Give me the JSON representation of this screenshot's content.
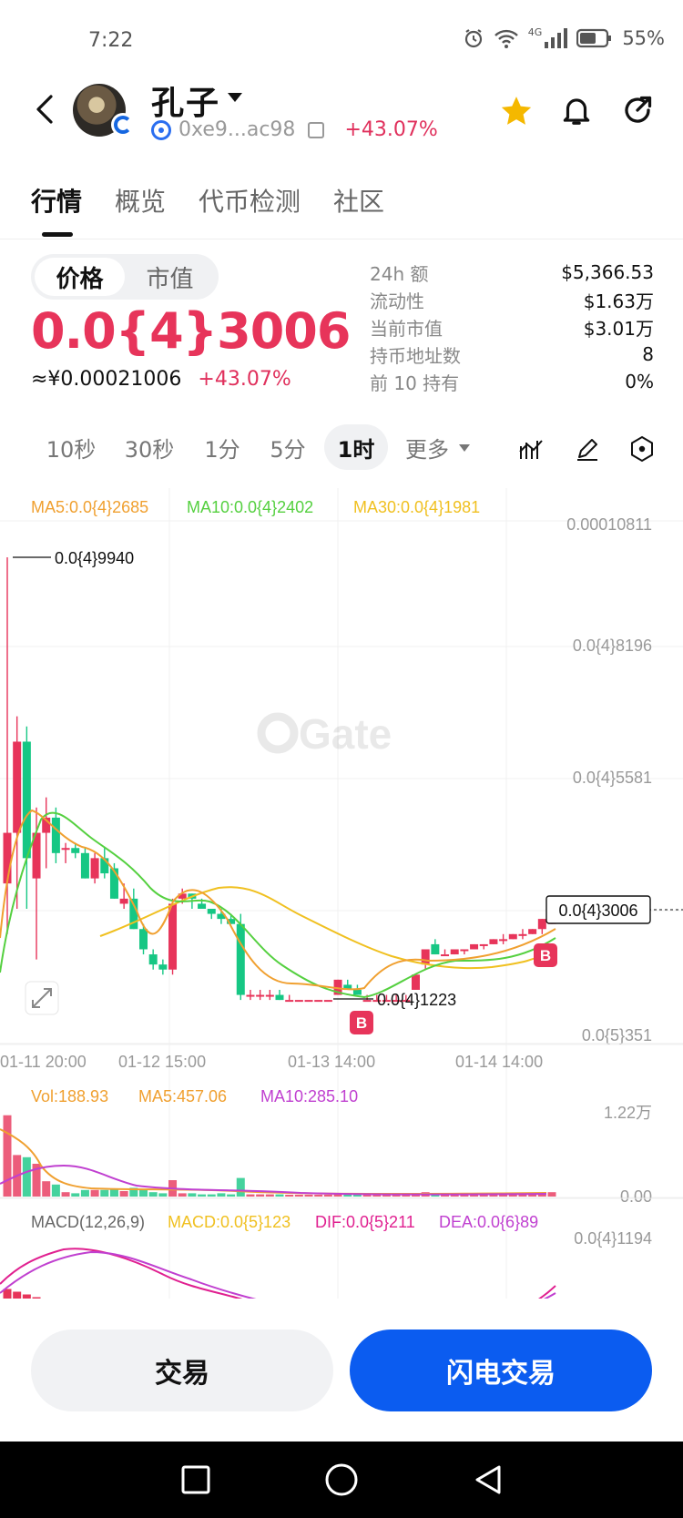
{
  "status_bar": {
    "time": "7:22",
    "battery": "55%",
    "network": "4G"
  },
  "header": {
    "token_name": "孔子",
    "address": "0xe9...ac98",
    "change": "+43.07%"
  },
  "tabs": [
    "行情",
    "概览",
    "代币检测",
    "社区"
  ],
  "price_panel": {
    "segment": [
      "价格",
      "市值"
    ],
    "price": "0.0{4}3006",
    "cny_price": "≈¥0.00021006",
    "change": "+43.07%"
  },
  "stats": [
    {
      "label": "24h  额",
      "value": "$5,366.53"
    },
    {
      "label": "流动性",
      "value": "$1.63万"
    },
    {
      "label": "当前市值",
      "value": "$3.01万"
    },
    {
      "label": "持币地址数",
      "value": "8"
    },
    {
      "label": "前 10 持有",
      "value": "0%"
    }
  ],
  "timeframes": [
    "10秒",
    "30秒",
    "1分",
    "5分",
    "1时",
    "更多"
  ],
  "selected_timeframe": "1时",
  "ma_legend": {
    "ma5": "MA5:0.0{4}2685",
    "ma10": "MA10:0.0{4}2402",
    "ma30": "MA30:0.0{4}1981"
  },
  "y_axis": [
    "0.00010811",
    "0.0{4}8196",
    "0.0{4}5581",
    "0.0{5}351"
  ],
  "x_axis": [
    "01-11 20:00",
    "01-12 15:00",
    "01-13 14:00",
    "01-14 14:00"
  ],
  "annotations": {
    "high": "0.0{4}9940",
    "low": "0.0{4}1223",
    "current": "0.0{4}3006",
    "buy_marker": "B"
  },
  "watermark": "Gate",
  "volume_legend": {
    "vol": "Vol:188.93",
    "ma5": "MA5:457.06",
    "ma10": "MA10:285.10",
    "max": "1.22万",
    "min": "0.00"
  },
  "macd_legend": {
    "label": "MACD(12,26,9)",
    "macd": "MACD:0.0{5}123",
    "dif": "DIF:0.0{5}211",
    "dea": "DEA:0.0{6}89",
    "max": "0.0{4}1194"
  },
  "buttons": {
    "trade": "交易",
    "flash_trade": "闪电交易"
  },
  "colors": {
    "up": "#e7345a",
    "down": "#16c784",
    "accent": "#0b5cf0",
    "ma5": "#f0a030",
    "ma10": "#55d040",
    "ma30": "#f0c020"
  },
  "chart_data": {
    "type": "candlestick",
    "interval": "1时",
    "x_ticks": [
      "01-11 20:00",
      "01-12 15:00",
      "01-13 14:00",
      "01-14 14:00"
    ],
    "y_ticks": [
      "0.00010811",
      "0.0{4}8196",
      "0.0{4}5581",
      "0.0{5}351"
    ],
    "high": "0.0{4}9940",
    "low": "0.0{4}1223",
    "last": "0.0{4}3006",
    "ma": {
      "MA5": "0.0{4}2685",
      "MA10": "0.0{4}2402",
      "MA30": "0.0{4}1981"
    },
    "candles": [
      {
        "o": 3.5e-05,
        "h": 9.94e-05,
        "l": 2.5e-05,
        "c": 4.5e-05
      },
      {
        "o": 4.5e-05,
        "h": 6.8e-05,
        "l": 3e-05,
        "c": 6.3e-05
      },
      {
        "o": 6.3e-05,
        "h": 6.6e-05,
        "l": 3e-05,
        "c": 4e-05
      },
      {
        "o": 3.6e-05,
        "h": 5e-05,
        "l": 2e-05,
        "c": 4.5e-05
      },
      {
        "o": 4.5e-05,
        "h": 5.2e-05,
        "l": 3.8e-05,
        "c": 4.8e-05
      },
      {
        "o": 4.8e-05,
        "h": 5e-05,
        "l": 3.9e-05,
        "c": 4.1e-05
      },
      {
        "o": 4.2e-05,
        "h": 4.3e-05,
        "l": 3.9e-05,
        "c": 4.2e-05
      },
      {
        "o": 4.2e-05,
        "h": 4.3e-05,
        "l": 4e-05,
        "c": 4.1e-05
      },
      {
        "o": 4.1e-05,
        "h": 4.2e-05,
        "l": 3.6e-05,
        "c": 3.6e-05
      },
      {
        "o": 3.6e-05,
        "h": 4.1e-05,
        "l": 3.5e-05,
        "c": 4e-05
      },
      {
        "o": 4e-05,
        "h": 4.2e-05,
        "l": 3.6e-05,
        "c": 3.7e-05
      },
      {
        "o": 3.8e-05,
        "h": 3.9e-05,
        "l": 3.2e-05,
        "c": 3.2e-05
      },
      {
        "o": 3.1e-05,
        "h": 3.5e-05,
        "l": 3e-05,
        "c": 3.2e-05
      },
      {
        "o": 3.2e-05,
        "h": 3.4e-05,
        "l": 2.6e-05,
        "c": 2.6e-05
      },
      {
        "o": 2.6e-05,
        "h": 2.7e-05,
        "l": 2.1e-05,
        "c": 2.2e-05
      },
      {
        "o": 2.1e-05,
        "h": 2.2e-05,
        "l": 1.8e-05,
        "c": 1.9e-05
      },
      {
        "o": 1.9e-05,
        "h": 2e-05,
        "l": 1.7e-05,
        "c": 1.8e-05
      },
      {
        "o": 1.8e-05,
        "h": 3.2e-05,
        "l": 1.7e-05,
        "c": 3.1e-05
      },
      {
        "o": 3.2e-05,
        "h": 3.4e-05,
        "l": 3.1e-05,
        "c": 3.3e-05
      },
      {
        "o": 3.3e-05,
        "h": 3.3e-05,
        "l": 3e-05,
        "c": 3.2e-05
      },
      {
        "o": 3.1e-05,
        "h": 3.2e-05,
        "l": 3e-05,
        "c": 3e-05
      },
      {
        "o": 3e-05,
        "h": 3e-05,
        "l": 2.8e-05,
        "c": 2.9e-05
      },
      {
        "o": 2.9e-05,
        "h": 3e-05,
        "l": 2.7e-05,
        "c": 2.8e-05
      },
      {
        "o": 2.8e-05,
        "h": 2.9e-05,
        "l": 2.7e-05,
        "c": 2.7e-05
      },
      {
        "o": 2.7e-05,
        "h": 2.9e-05,
        "l": 1.2e-05,
        "c": 1.3e-05
      },
      {
        "o": 1.3e-05,
        "h": 1.4e-05,
        "l": 1.2e-05,
        "c": 1.3e-05
      },
      {
        "o": 1.3e-05,
        "h": 1.4e-05,
        "l": 1.2e-05,
        "c": 1.3e-05
      },
      {
        "o": 1.3e-05,
        "h": 1.4e-05,
        "l": 1.2e-05,
        "c": 1.3e-05
      },
      {
        "o": 1.3e-05,
        "h": 1.4e-05,
        "l": 1.2e-05,
        "c": 1.2e-05
      },
      {
        "o": 1.2e-05,
        "h": 1.3e-05,
        "l": 1.2e-05,
        "c": 1.2e-05
      },
      {
        "o": 1.2e-05,
        "h": 1.2e-05,
        "l": 1.2e-05,
        "c": 1.2e-05
      },
      {
        "o": 1.2e-05,
        "h": 1.2e-05,
        "l": 1.2e-05,
        "c": 1.2e-05
      },
      {
        "o": 1.2e-05,
        "h": 1.2e-05,
        "l": 1.2e-05,
        "c": 1.2e-05
      },
      {
        "o": 1.2e-05,
        "h": 1.2e-05,
        "l": 1.2e-05,
        "c": 1.2e-05
      },
      {
        "o": 1.3e-05,
        "h": 1.6e-05,
        "l": 1.3e-05,
        "c": 1.6e-05
      },
      {
        "o": 1.5e-05,
        "h": 1.6e-05,
        "l": 1.4e-05,
        "c": 1.4e-05
      },
      {
        "o": 1.4e-05,
        "h": 1.5e-05,
        "l": 1.3e-05,
        "c": 1.3e-05
      },
      {
        "o": 1.2e-05,
        "h": 1.3e-05,
        "l": 1.2e-05,
        "c": 1.2e-05
      },
      {
        "o": 1.2e-05,
        "h": 1.3e-05,
        "l": 1.2e-05,
        "c": 1.2e-05
      },
      {
        "o": 1.2e-05,
        "h": 1.3e-05,
        "l": 1.2e-05,
        "c": 1.2e-05
      },
      {
        "o": 1.2e-05,
        "h": 1.3e-05,
        "l": 1.2e-05,
        "c": 1.2e-05
      },
      {
        "o": 1.2e-05,
        "h": 1.3e-05,
        "l": 1.2e-05,
        "c": 1.2e-05
      },
      {
        "o": 1.4e-05,
        "h": 1.7e-05,
        "l": 1.4e-05,
        "c": 1.7e-05
      },
      {
        "o": 1.9e-05,
        "h": 2.2e-05,
        "l": 1.8e-05,
        "c": 2.2e-05
      },
      {
        "o": 2.3e-05,
        "h": 2.4e-05,
        "l": 2.1e-05,
        "c": 2.1e-05
      },
      {
        "o": 2.1e-05,
        "h": 2.2e-05,
        "l": 2.1e-05,
        "c": 2.1e-05
      },
      {
        "o": 2.1e-05,
        "h": 2.2e-05,
        "l": 2.1e-05,
        "c": 2.2e-05
      },
      {
        "o": 2.2e-05,
        "h": 2.2e-05,
        "l": 2.1e-05,
        "c": 2.2e-05
      },
      {
        "o": 2.2e-05,
        "h": 2.3e-05,
        "l": 2.2e-05,
        "c": 2.3e-05
      },
      {
        "o": 2.3e-05,
        "h": 2.3e-05,
        "l": 2.2e-05,
        "c": 2.3e-05
      },
      {
        "o": 2.3e-05,
        "h": 2.4e-05,
        "l": 2.3e-05,
        "c": 2.4e-05
      },
      {
        "o": 2.4e-05,
        "h": 2.5e-05,
        "l": 2.3e-05,
        "c": 2.4e-05
      },
      {
        "o": 2.4e-05,
        "h": 2.5e-05,
        "l": 2.4e-05,
        "c": 2.5e-05
      },
      {
        "o": 2.5e-05,
        "h": 2.6e-05,
        "l": 2.4e-05,
        "c": 2.5e-05
      },
      {
        "o": 2.5e-05,
        "h": 2.6e-05,
        "l": 2.5e-05,
        "c": 2.6e-05
      },
      {
        "o": 2.6e-05,
        "h": 2.8e-05,
        "l": 2.5e-05,
        "c": 2.8e-05
      },
      {
        "o": 2.7e-05,
        "h": 3.1e-05,
        "l": 2.7e-05,
        "c": 3.01e-05
      }
    ]
  }
}
